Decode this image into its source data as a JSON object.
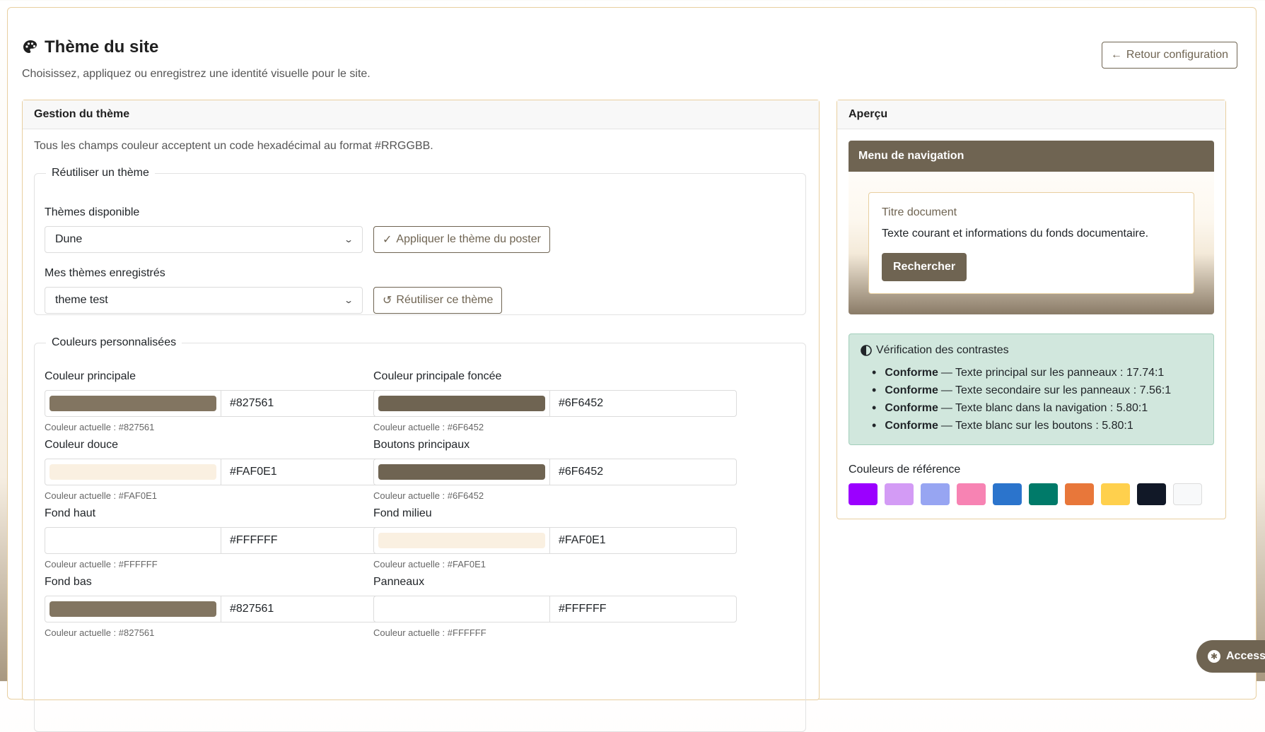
{
  "header": {
    "title": "Thème du site",
    "subtitle": "Choisissez, appliquez ou enregistrez une identité visuelle pour le site.",
    "back_label": "Retour configuration"
  },
  "theme_card": {
    "title": "Gestion du thème",
    "hint": "Tous les champs couleur acceptent un code hexadécimal au format #RRGGBB.",
    "reuse": {
      "legend": "Réutiliser un thème",
      "available_label": "Thèmes disponible",
      "available_value": "Dune",
      "apply_label": "Appliquer le thème du poster",
      "saved_label": "Mes thèmes enregistrés",
      "saved_value": "theme test",
      "reuse_label": "Réutiliser ce thème"
    },
    "custom": {
      "legend": "Couleurs personnalisées",
      "fields": [
        {
          "label": "Couleur principale",
          "hex": "#827561",
          "current": "Couleur actuelle : #827561",
          "color": "#827561"
        },
        {
          "label": "Couleur principale foncée",
          "hex": "#6F6452",
          "current": "Couleur actuelle : #6F6452",
          "color": "#6F6452"
        },
        {
          "label": "Couleur douce",
          "hex": "#FAF0E1",
          "current": "Couleur actuelle : #FAF0E1",
          "color": "#FAF0E1"
        },
        {
          "label": "Boutons principaux",
          "hex": "#6F6452",
          "current": "Couleur actuelle : #6F6452",
          "color": "#6F6452"
        },
        {
          "label": "Fond haut",
          "hex": "#FFFFFF",
          "current": "Couleur actuelle : #FFFFFF",
          "color": "#FFFFFF"
        },
        {
          "label": "Fond milieu",
          "hex": "#FAF0E1",
          "current": "Couleur actuelle : #FAF0E1",
          "color": "#FAF0E1"
        },
        {
          "label": "Fond bas",
          "hex": "#827561",
          "current": "Couleur actuelle : #827561",
          "color": "#827561"
        },
        {
          "label": "Panneaux",
          "hex": "#FFFFFF",
          "current": "Couleur actuelle : #FFFFFF",
          "color": "#FFFFFF"
        }
      ]
    }
  },
  "preview": {
    "title": "Aperçu",
    "nav_label": "Menu de navigation",
    "doc_title": "Titre document",
    "doc_text": "Texte courant et informations du fonds documentaire.",
    "search_label": "Rechercher",
    "contrast": {
      "title": "Vérification des contrastes",
      "items": [
        {
          "status": "Conforme",
          "text": "— Texte principal sur les panneaux : 17.74:1"
        },
        {
          "status": "Conforme",
          "text": "— Texte secondaire sur les panneaux : 7.56:1"
        },
        {
          "status": "Conforme",
          "text": "— Texte blanc dans la navigation : 5.80:1"
        },
        {
          "status": "Conforme",
          "text": "— Texte blanc sur les boutons : 5.80:1"
        }
      ]
    },
    "ref_label": "Couleurs de référence",
    "ref_colors": [
      "#9B00FF",
      "#D39BF5",
      "#97A5F2",
      "#F783B3",
      "#2B74CC",
      "#007A69",
      "#E8773A",
      "#FFD04D",
      "#111827",
      "#F8F9FA"
    ]
  },
  "accessibility": {
    "label": "Access"
  }
}
